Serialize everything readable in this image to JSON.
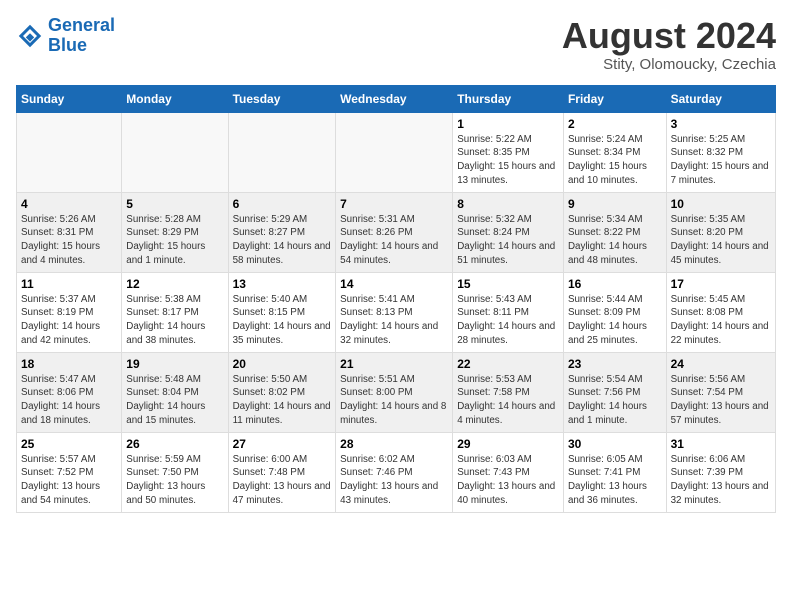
{
  "logo": {
    "line1": "General",
    "line2": "Blue"
  },
  "title": "August 2024",
  "subtitle": "Stity, Olomoucky, Czechia",
  "days_header": [
    "Sunday",
    "Monday",
    "Tuesday",
    "Wednesday",
    "Thursday",
    "Friday",
    "Saturday"
  ],
  "weeks": [
    [
      {
        "num": "",
        "sunrise": "",
        "sunset": "",
        "daylight": ""
      },
      {
        "num": "",
        "sunrise": "",
        "sunset": "",
        "daylight": ""
      },
      {
        "num": "",
        "sunrise": "",
        "sunset": "",
        "daylight": ""
      },
      {
        "num": "",
        "sunrise": "",
        "sunset": "",
        "daylight": ""
      },
      {
        "num": "1",
        "sunrise": "Sunrise: 5:22 AM",
        "sunset": "Sunset: 8:35 PM",
        "daylight": "Daylight: 15 hours and 13 minutes."
      },
      {
        "num": "2",
        "sunrise": "Sunrise: 5:24 AM",
        "sunset": "Sunset: 8:34 PM",
        "daylight": "Daylight: 15 hours and 10 minutes."
      },
      {
        "num": "3",
        "sunrise": "Sunrise: 5:25 AM",
        "sunset": "Sunset: 8:32 PM",
        "daylight": "Daylight: 15 hours and 7 minutes."
      }
    ],
    [
      {
        "num": "4",
        "sunrise": "Sunrise: 5:26 AM",
        "sunset": "Sunset: 8:31 PM",
        "daylight": "Daylight: 15 hours and 4 minutes."
      },
      {
        "num": "5",
        "sunrise": "Sunrise: 5:28 AM",
        "sunset": "Sunset: 8:29 PM",
        "daylight": "Daylight: 15 hours and 1 minute."
      },
      {
        "num": "6",
        "sunrise": "Sunrise: 5:29 AM",
        "sunset": "Sunset: 8:27 PM",
        "daylight": "Daylight: 14 hours and 58 minutes."
      },
      {
        "num": "7",
        "sunrise": "Sunrise: 5:31 AM",
        "sunset": "Sunset: 8:26 PM",
        "daylight": "Daylight: 14 hours and 54 minutes."
      },
      {
        "num": "8",
        "sunrise": "Sunrise: 5:32 AM",
        "sunset": "Sunset: 8:24 PM",
        "daylight": "Daylight: 14 hours and 51 minutes."
      },
      {
        "num": "9",
        "sunrise": "Sunrise: 5:34 AM",
        "sunset": "Sunset: 8:22 PM",
        "daylight": "Daylight: 14 hours and 48 minutes."
      },
      {
        "num": "10",
        "sunrise": "Sunrise: 5:35 AM",
        "sunset": "Sunset: 8:20 PM",
        "daylight": "Daylight: 14 hours and 45 minutes."
      }
    ],
    [
      {
        "num": "11",
        "sunrise": "Sunrise: 5:37 AM",
        "sunset": "Sunset: 8:19 PM",
        "daylight": "Daylight: 14 hours and 42 minutes."
      },
      {
        "num": "12",
        "sunrise": "Sunrise: 5:38 AM",
        "sunset": "Sunset: 8:17 PM",
        "daylight": "Daylight: 14 hours and 38 minutes."
      },
      {
        "num": "13",
        "sunrise": "Sunrise: 5:40 AM",
        "sunset": "Sunset: 8:15 PM",
        "daylight": "Daylight: 14 hours and 35 minutes."
      },
      {
        "num": "14",
        "sunrise": "Sunrise: 5:41 AM",
        "sunset": "Sunset: 8:13 PM",
        "daylight": "Daylight: 14 hours and 32 minutes."
      },
      {
        "num": "15",
        "sunrise": "Sunrise: 5:43 AM",
        "sunset": "Sunset: 8:11 PM",
        "daylight": "Daylight: 14 hours and 28 minutes."
      },
      {
        "num": "16",
        "sunrise": "Sunrise: 5:44 AM",
        "sunset": "Sunset: 8:09 PM",
        "daylight": "Daylight: 14 hours and 25 minutes."
      },
      {
        "num": "17",
        "sunrise": "Sunrise: 5:45 AM",
        "sunset": "Sunset: 8:08 PM",
        "daylight": "Daylight: 14 hours and 22 minutes."
      }
    ],
    [
      {
        "num": "18",
        "sunrise": "Sunrise: 5:47 AM",
        "sunset": "Sunset: 8:06 PM",
        "daylight": "Daylight: 14 hours and 18 minutes."
      },
      {
        "num": "19",
        "sunrise": "Sunrise: 5:48 AM",
        "sunset": "Sunset: 8:04 PM",
        "daylight": "Daylight: 14 hours and 15 minutes."
      },
      {
        "num": "20",
        "sunrise": "Sunrise: 5:50 AM",
        "sunset": "Sunset: 8:02 PM",
        "daylight": "Daylight: 14 hours and 11 minutes."
      },
      {
        "num": "21",
        "sunrise": "Sunrise: 5:51 AM",
        "sunset": "Sunset: 8:00 PM",
        "daylight": "Daylight: 14 hours and 8 minutes."
      },
      {
        "num": "22",
        "sunrise": "Sunrise: 5:53 AM",
        "sunset": "Sunset: 7:58 PM",
        "daylight": "Daylight: 14 hours and 4 minutes."
      },
      {
        "num": "23",
        "sunrise": "Sunrise: 5:54 AM",
        "sunset": "Sunset: 7:56 PM",
        "daylight": "Daylight: 14 hours and 1 minute."
      },
      {
        "num": "24",
        "sunrise": "Sunrise: 5:56 AM",
        "sunset": "Sunset: 7:54 PM",
        "daylight": "Daylight: 13 hours and 57 minutes."
      }
    ],
    [
      {
        "num": "25",
        "sunrise": "Sunrise: 5:57 AM",
        "sunset": "Sunset: 7:52 PM",
        "daylight": "Daylight: 13 hours and 54 minutes."
      },
      {
        "num": "26",
        "sunrise": "Sunrise: 5:59 AM",
        "sunset": "Sunset: 7:50 PM",
        "daylight": "Daylight: 13 hours and 50 minutes."
      },
      {
        "num": "27",
        "sunrise": "Sunrise: 6:00 AM",
        "sunset": "Sunset: 7:48 PM",
        "daylight": "Daylight: 13 hours and 47 minutes."
      },
      {
        "num": "28",
        "sunrise": "Sunrise: 6:02 AM",
        "sunset": "Sunset: 7:46 PM",
        "daylight": "Daylight: 13 hours and 43 minutes."
      },
      {
        "num": "29",
        "sunrise": "Sunrise: 6:03 AM",
        "sunset": "Sunset: 7:43 PM",
        "daylight": "Daylight: 13 hours and 40 minutes."
      },
      {
        "num": "30",
        "sunrise": "Sunrise: 6:05 AM",
        "sunset": "Sunset: 7:41 PM",
        "daylight": "Daylight: 13 hours and 36 minutes."
      },
      {
        "num": "31",
        "sunrise": "Sunrise: 6:06 AM",
        "sunset": "Sunset: 7:39 PM",
        "daylight": "Daylight: 13 hours and 32 minutes."
      }
    ]
  ]
}
